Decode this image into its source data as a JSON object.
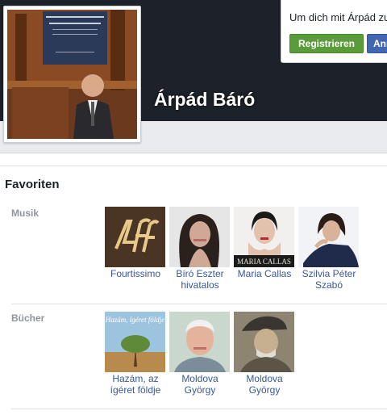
{
  "profile": {
    "name": "Árpád Báró"
  },
  "signup": {
    "text": "Um dich mit Árpád zu verbinden,",
    "register_label": "Registrieren",
    "login_label": "Anmelden"
  },
  "favorites": {
    "title": "Favoriten",
    "music_label": "Musik",
    "books_label": "Bücher",
    "music": [
      {
        "name": "Fourtissimo",
        "icon": "fourtissimo-logo"
      },
      {
        "name": "Bíró Eszter hivatalos",
        "icon": "portrait-photo"
      },
      {
        "name": "Maria Callas",
        "icon": "album-cover",
        "cover_text": "MARIA CALLAS"
      },
      {
        "name": "Szilvia Péter Szabó",
        "icon": "portrait-photo"
      }
    ],
    "books": [
      {
        "name": "Hazám, az ígéret földje",
        "icon": "book-cover",
        "cover_text": "Hazám, ígéret földje"
      },
      {
        "name": "Moldova György",
        "icon": "portrait-photo"
      },
      {
        "name": "Moldova György",
        "icon": "portrait-photo"
      }
    ]
  },
  "colors": {
    "cover": "#1d2129",
    "link": "#385898",
    "register": "#5b9c3a",
    "login": "#4267b2"
  }
}
